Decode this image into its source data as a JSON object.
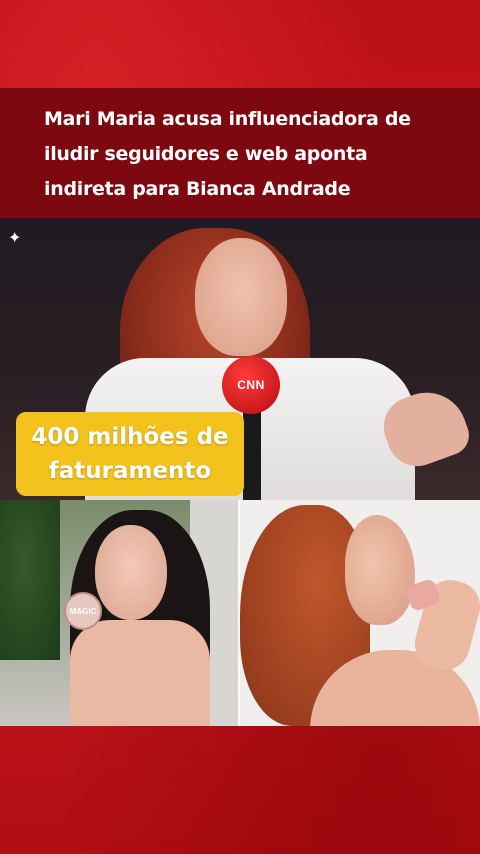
{
  "headline": {
    "lines": [
      "Mari Maria acusa influenciadora de",
      "iludir seguidores e web aponta",
      "indireta para Bianca Andrade"
    ]
  },
  "video": {
    "mic_logo": "CNN",
    "caption_lines": [
      "400 milhões de",
      "faturamento"
    ]
  },
  "photos": {
    "left_compact_label": "MAGIC"
  },
  "colors": {
    "background": "#c3121a",
    "headline_band": "#7d0810",
    "caption_box": "#f4c21d"
  },
  "icons": {
    "sparkle": "sparkle-icon"
  }
}
